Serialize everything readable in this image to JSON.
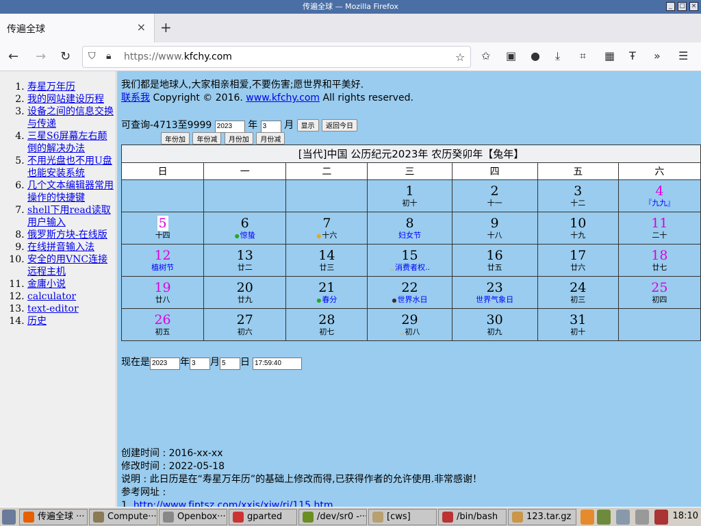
{
  "window": {
    "title": "传遍全球 — Mozilla Firefox"
  },
  "tab": {
    "title": "传遍全球"
  },
  "url": {
    "prefix": "https://www.",
    "domain": "kfchy.com"
  },
  "sidebar": [
    "寿星万年历",
    "我的网站建设历程",
    "设备之间的信息交换与传递",
    "三星S6屏幕左右颠倒的解决办法",
    "不用光盘也不用U盘也能安装系统",
    "几个文本编辑器常用操作的快捷键",
    "shell下用read读取用户输入",
    "俄罗斯方块-在线版",
    "在线拼音输入法",
    "安全的用VNC连接远程主机",
    "金庸小说",
    "calculator",
    "text-editor",
    "历史"
  ],
  "header": {
    "motto": "我们都是地球人,大家相亲相爱,不要伤害;愿世界和平美好.",
    "contact": "联系我",
    "copy_text": " Copyright © 2016. ",
    "site": "www.kfchy.com",
    "rights": " All rights reserved."
  },
  "query": {
    "label": "可查询-4713至9999",
    "year_value": "2023",
    "year_unit": "年",
    "month_value": "3",
    "month_unit": "月",
    "show": "显示",
    "today": "返回今日",
    "year_plus": "年份加",
    "year_minus": "年份减",
    "month_plus": "月份加",
    "month_minus": "月份减"
  },
  "calendar": {
    "caption": "[当代]中国  公历纪元2023年 农历癸卯年【兔年】",
    "weekdays": [
      "日",
      "一",
      "二",
      "三",
      "四",
      "五",
      "六"
    ],
    "weeks": [
      [
        null,
        null,
        null,
        {
          "d": "1",
          "s": "初十"
        },
        {
          "d": "2",
          "s": "十一"
        },
        {
          "d": "3",
          "s": "十二"
        },
        {
          "d": "4",
          "s": "『九九』",
          "f": true
        }
      ],
      [
        {
          "d": "5",
          "s": "十四",
          "today": true
        },
        {
          "d": "6",
          "s": "惊蛰",
          "f": true,
          "dot": "#22aa22"
        },
        {
          "d": "7",
          "s": "十六",
          "dot": "#e6a817"
        },
        {
          "d": "8",
          "s": "妇女节",
          "f": true
        },
        {
          "d": "9",
          "s": "十八"
        },
        {
          "d": "10",
          "s": "十九"
        },
        {
          "d": "11",
          "s": "二十"
        }
      ],
      [
        {
          "d": "12",
          "s": "植树节",
          "f": true
        },
        {
          "d": "13",
          "s": "廿二"
        },
        {
          "d": "14",
          "s": "廿三"
        },
        {
          "d": "15",
          "s": "消费者权..",
          "f": true,
          "dot": "#e6a817",
          "moon": true
        },
        {
          "d": "16",
          "s": "廿五"
        },
        {
          "d": "17",
          "s": "廿六"
        },
        {
          "d": "18",
          "s": "廿七"
        }
      ],
      [
        {
          "d": "19",
          "s": "廿八"
        },
        {
          "d": "20",
          "s": "廿九"
        },
        {
          "d": "21",
          "s": "春分",
          "f": true,
          "dot": "#22aa22"
        },
        {
          "d": "22",
          "s": "世界水日",
          "f": true,
          "dot": "#333"
        },
        {
          "d": "23",
          "s": "世界气象日",
          "f": true
        },
        {
          "d": "24",
          "s": "初三"
        },
        {
          "d": "25",
          "s": "初四"
        }
      ],
      [
        {
          "d": "26",
          "s": "初五"
        },
        {
          "d": "27",
          "s": "初六"
        },
        {
          "d": "28",
          "s": "初七"
        },
        {
          "d": "29",
          "s": "初八",
          "dot": "#e6a817",
          "moon": true
        },
        {
          "d": "30",
          "s": "初九"
        },
        {
          "d": "31",
          "s": "初十"
        },
        null
      ]
    ]
  },
  "now": {
    "label": "现在是",
    "year": "2023",
    "year_unit": "年",
    "month": "3",
    "month_unit": "月",
    "day": "5",
    "day_unit": "日",
    "time": "17:59:40"
  },
  "meta": {
    "created": "创建时间 : 2016-xx-xx",
    "modified": "修改时间 : 2022-05-18",
    "note": "说明 : 此日历是在“寿星万年历”的基础上修改而得,已获得作者的允许使用.非常感谢！",
    "ref_label": "参考网址 :",
    "ref_link": "http://www.fjptsz.com/xxjs/xjw/rj/115.htm"
  },
  "taskbar": {
    "tasks": [
      "传遍全球 ···",
      "Compute···",
      "Openbox···",
      "gparted",
      "/dev/sr0 -···",
      "[cws]",
      "/bin/bash",
      "123.tar.gz"
    ],
    "clock": "18:10"
  },
  "colors": {
    "weekend": "#dd00dd",
    "festival": "#0000ff",
    "page_bg": "#99ccee",
    "titlebar": "#4a6fa5"
  }
}
